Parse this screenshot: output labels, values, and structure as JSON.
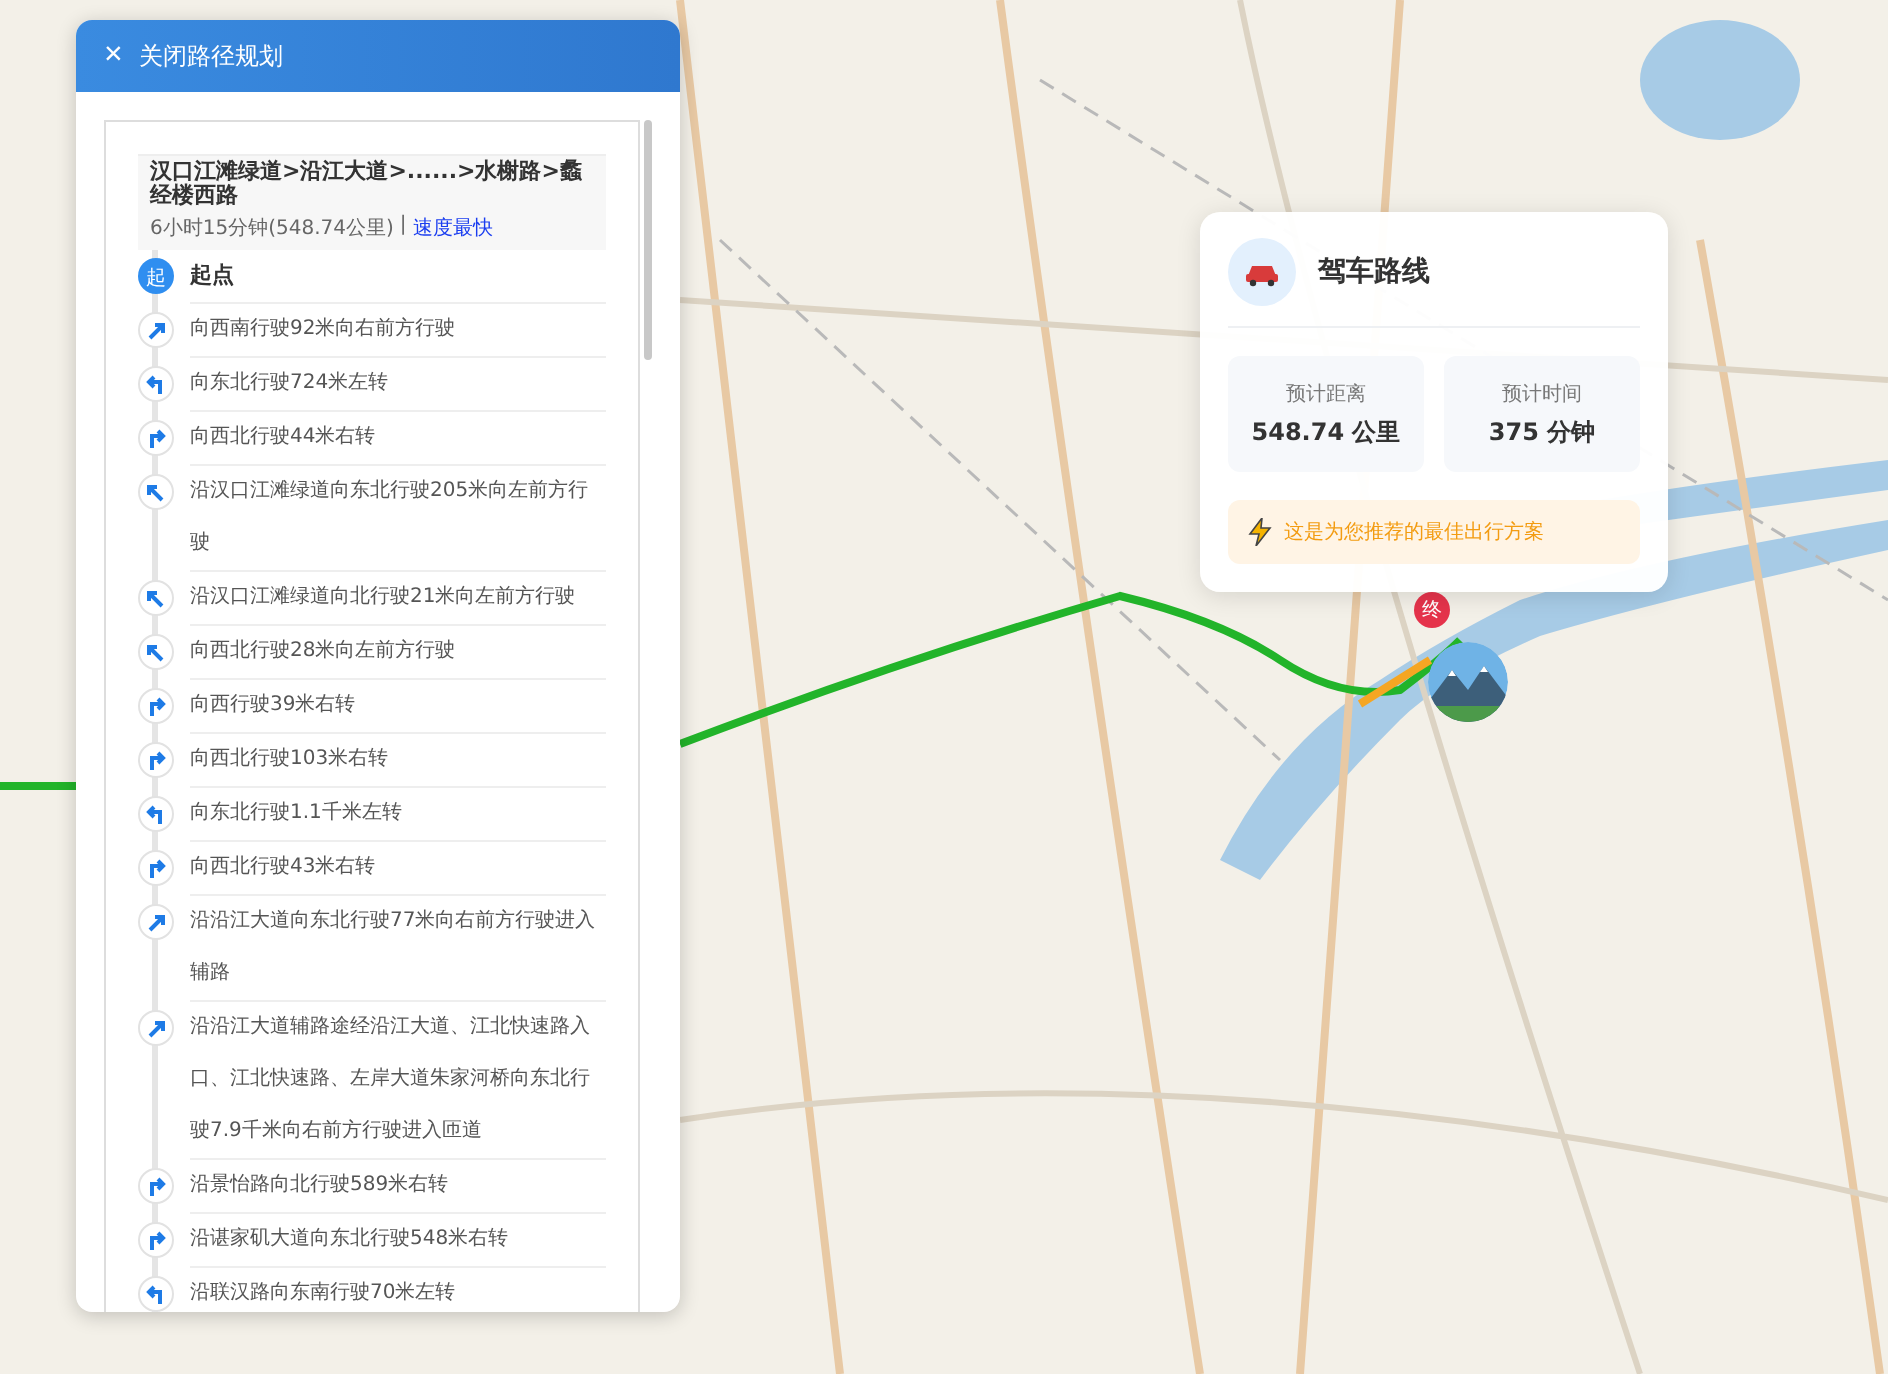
{
  "panel": {
    "close_icon": "×",
    "title": "关闭路径规划"
  },
  "summary": {
    "route": "汉口江滩绿道>沿江大道>......>水榭路>蠡经楼西路",
    "duration": "6小时15分钟(548.74公里)",
    "separator": "|",
    "tag": "速度最快"
  },
  "start": {
    "badge": "起",
    "label": "起点"
  },
  "steps": [
    {
      "kind": "slight-right",
      "text": "向西南行驶92米向右前方行驶"
    },
    {
      "kind": "left",
      "text": "向东北行驶724米左转"
    },
    {
      "kind": "right",
      "text": "向西北行驶44米右转"
    },
    {
      "kind": "slight-left",
      "text": "沿汉口江滩绿道向东北行驶205米向左前方行驶"
    },
    {
      "kind": "slight-left",
      "text": "沿汉口江滩绿道向北行驶21米向左前方行驶"
    },
    {
      "kind": "slight-left",
      "text": "向西北行驶28米向左前方行驶"
    },
    {
      "kind": "right",
      "text": "向西行驶39米右转"
    },
    {
      "kind": "right",
      "text": "向西北行驶103米右转"
    },
    {
      "kind": "left",
      "text": "向东北行驶1.1千米左转"
    },
    {
      "kind": "right",
      "text": "向西北行驶43米右转"
    },
    {
      "kind": "slight-right",
      "text": "沿沿江大道向东北行驶77米向右前方行驶进入辅路"
    },
    {
      "kind": "slight-right",
      "text": "沿沿江大道辅路途经沿江大道、江北快速路入口、江北快速路、左岸大道朱家河桥向东北行驶7.9千米向右前方行驶进入匝道"
    },
    {
      "kind": "right",
      "text": "沿景怡路向北行驶589米右转"
    },
    {
      "kind": "right",
      "text": "沿谌家矶大道向东北行驶548米右转"
    },
    {
      "kind": "left",
      "text": "沿联汉路向东南行驶70米左转"
    }
  ],
  "end_marker": "终",
  "card": {
    "title": "驾车路线",
    "stats": [
      {
        "label": "预计距离",
        "value": "548.74 公里"
      },
      {
        "label": "预计时间",
        "value": "375 分钟"
      }
    ],
    "note": "这是为您推荐的最佳出行方案"
  }
}
